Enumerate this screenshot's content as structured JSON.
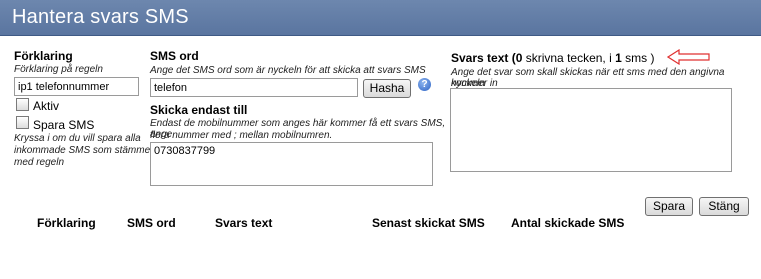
{
  "window": {
    "title": "Hantera svars SMS"
  },
  "forklaring": {
    "label": "Förklaring",
    "hint": "Förklaring på regeln",
    "value": "ip1 telefonnummer",
    "aktiv_label": "Aktiv",
    "spara_label": "Spara SMS",
    "spara_hint_lines": [
      "Kryssa i om du vill spara alla",
      "inkommade SMS som stämmer",
      "med regeln"
    ]
  },
  "sms_ord": {
    "label": "SMS ord",
    "hint": "Ange det SMS ord som är nyckeln för att skicka att svars SMS",
    "value": "telefon",
    "hash_button": "Hasha",
    "help_icon": "help-icon"
  },
  "skicka_endast": {
    "label": "Skicka endast till",
    "hint_lines": [
      "Endast de mobilnummer som anges här kommer få ett svars SMS, ange",
      "flera nummer med ; mellan mobilnumren."
    ],
    "value": "0730837799"
  },
  "svars_text": {
    "label_prefix": "Svars text (",
    "count": "0",
    "count_text": " skrivna tecken, i ",
    "sms_count": "1",
    "sms_text": " sms )",
    "hint_lines": [
      "Ange det svar som skall skickas när ett sms med den angivna nyckeln",
      "kommer in"
    ],
    "value": "",
    "arrow_color": "#e03030"
  },
  "actions": {
    "save": "Spara",
    "close": "Stäng"
  },
  "table": {
    "headers": [
      "Förklaring",
      "SMS ord",
      "Svars text",
      "Senast skickat SMS",
      "Antal skickade SMS"
    ]
  }
}
